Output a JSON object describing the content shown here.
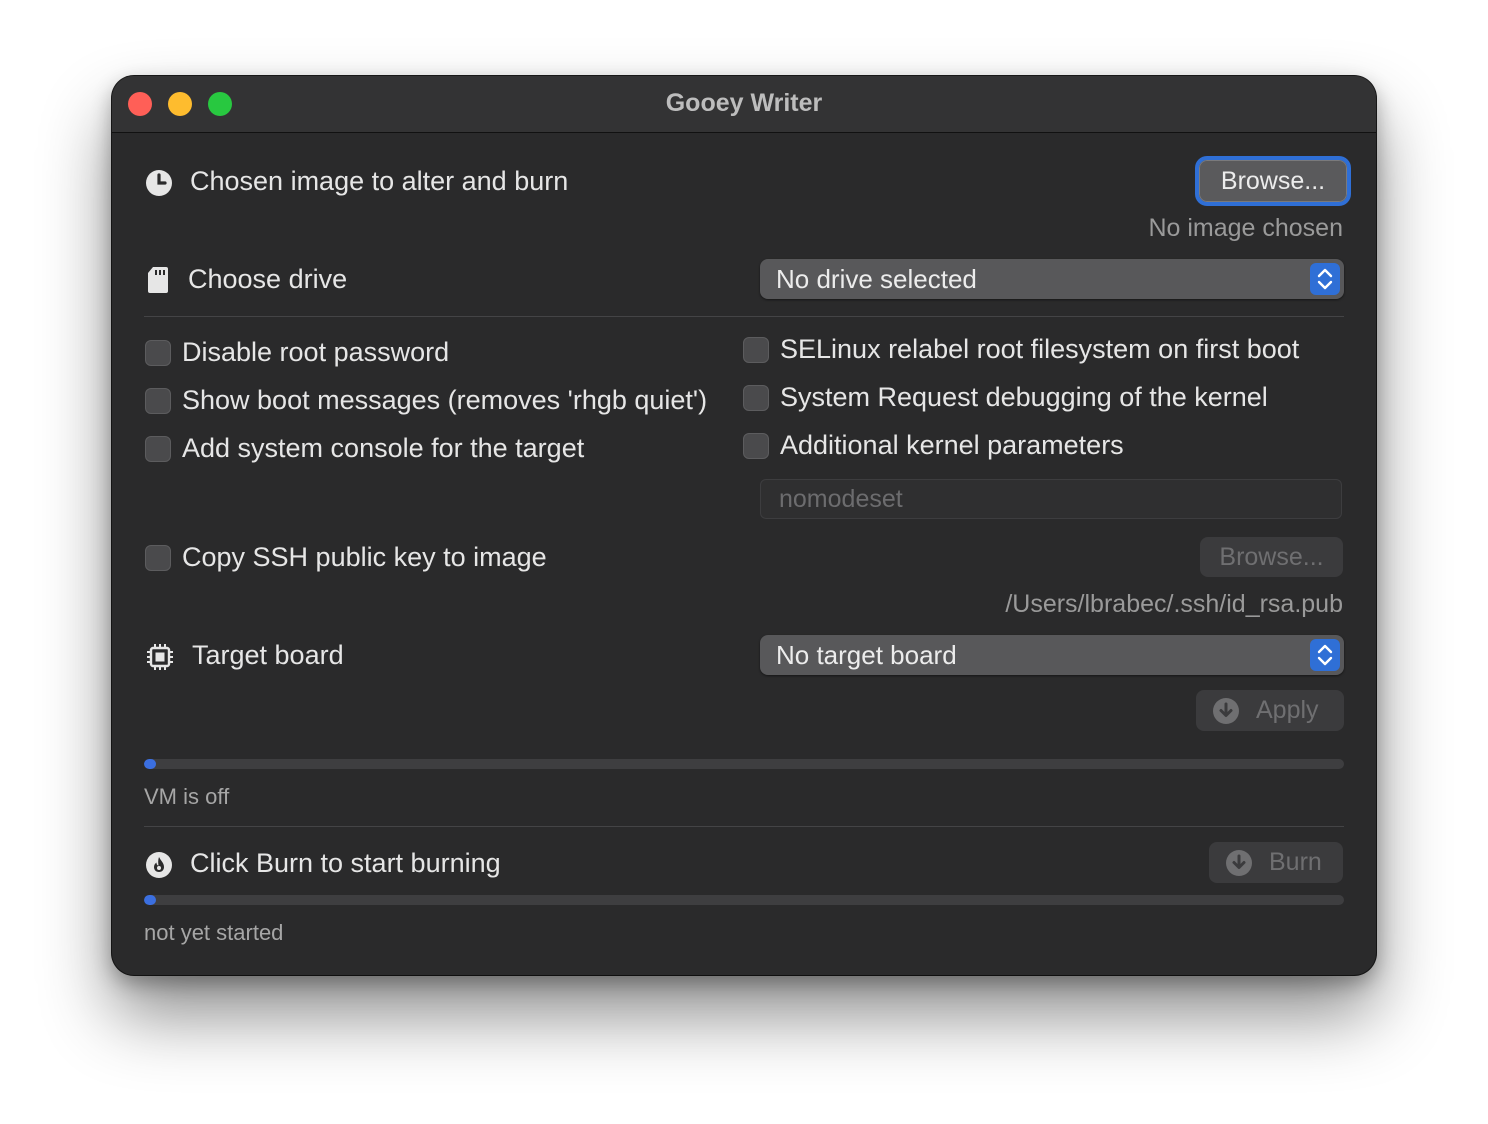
{
  "window": {
    "title": "Gooey Writer"
  },
  "image": {
    "label": "Chosen image to alter and burn",
    "browse_label": "Browse...",
    "status": "No image chosen"
  },
  "drive": {
    "label": "Choose drive",
    "selected": "No drive selected"
  },
  "options_left": [
    {
      "label": "Disable root password",
      "checked": false
    },
    {
      "label": "Show boot messages (removes 'rhgb quiet')",
      "checked": false
    },
    {
      "label": "Add system console for the target",
      "checked": false
    }
  ],
  "options_right": [
    {
      "label": "SELinux relabel root filesystem on first boot",
      "checked": false
    },
    {
      "label": "System Request debugging of the kernel",
      "checked": false
    },
    {
      "label": "Additional kernel parameters",
      "checked": false
    }
  ],
  "kernel_params": {
    "placeholder": "nomodeset"
  },
  "ssh": {
    "label": "Copy SSH public key to image",
    "checked": false,
    "browse_label": "Browse...",
    "path": "/Users/lbrabec/.ssh/id_rsa.pub"
  },
  "board": {
    "label": "Target board",
    "selected": "No target board",
    "apply_label": "Apply"
  },
  "vm": {
    "status": "VM is off",
    "progress": 0
  },
  "burn": {
    "label": "Click Burn to start burning",
    "burn_label": "Burn",
    "status": "not yet started",
    "progress": 0
  },
  "colors": {
    "accent": "#2f6fd6",
    "window_bg": "#2a2a2b",
    "progress_fill": "#3b6fe0"
  },
  "icons": {
    "image": "clock-file-icon",
    "drive": "sd-card-icon",
    "board": "chip-icon",
    "apply": "download-circle-icon",
    "burn_section": "flame-icon",
    "burn": "download-circle-icon"
  }
}
